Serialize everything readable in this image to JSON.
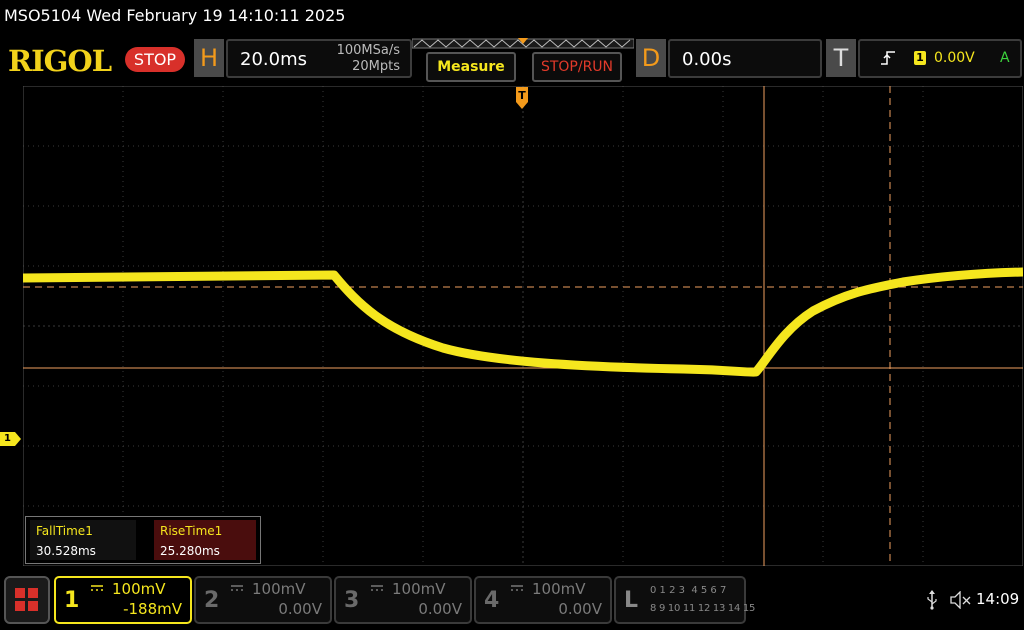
{
  "header": {
    "title": "MSO5104  Wed February 19 14:10:11 2025"
  },
  "brand": {
    "logo": "RIGOL",
    "status": "STOP"
  },
  "horizontal": {
    "letter": "H",
    "timebase": "20.0ms",
    "sample_rate": "100MSa/s",
    "memory_depth": "20Mpts"
  },
  "buttons": {
    "measure": "Measure",
    "stop_run": "STOP/RUN"
  },
  "delay": {
    "letter": "D",
    "value": "0.00s"
  },
  "trigger": {
    "letter": "T",
    "source": "1",
    "level": "0.00V",
    "mode": "A"
  },
  "measurements": {
    "items": [
      {
        "label": "FallTime1",
        "value": "30.528ms"
      },
      {
        "label": "RiseTime1",
        "value": "25.280ms"
      }
    ]
  },
  "channels": [
    {
      "num": "1",
      "scale": "100mV",
      "offset": "-188mV",
      "active": true
    },
    {
      "num": "2",
      "scale": "100mV",
      "offset": "0.00V",
      "active": false
    },
    {
      "num": "3",
      "scale": "100mV",
      "offset": "0.00V",
      "active": false
    },
    {
      "num": "4",
      "scale": "100mV",
      "offset": "0.00V",
      "active": false
    }
  ],
  "logic": {
    "letter": "L",
    "row1": "0 1 2 3  4 5 6 7",
    "row2": "8 9 10 11 12 13 14 15"
  },
  "status_tray": {
    "time": "14:09"
  },
  "markers": {
    "channel_marker": "1",
    "trigger_marker": "T"
  },
  "colors": {
    "channel1": "#f5e61e",
    "cursor": "#f0a060",
    "accent": "#f39a1b",
    "stop": "#d8302a"
  }
}
